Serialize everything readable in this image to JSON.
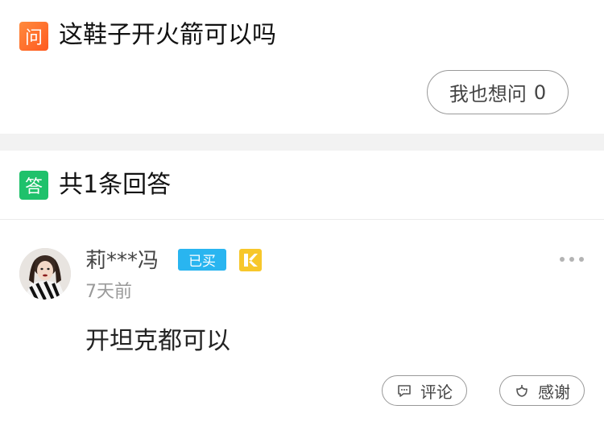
{
  "question": {
    "badge": "问",
    "title": "这鞋子开火箭可以吗",
    "ask_button_label": "我也想问",
    "ask_count": "0"
  },
  "answers_header": {
    "badge": "答",
    "count_label": "共1条回答"
  },
  "answer": {
    "user_name": "莉***冯",
    "bought_tag": "已买",
    "vip_icon": "vip-badge-icon",
    "time": "7天前",
    "text": "开坦克都可以",
    "comment_label": "评论",
    "thanks_label": "感谢"
  },
  "colors": {
    "question_badge": "#ff6a2a",
    "answer_badge": "#1fc16b",
    "bought_tag": "#29b5f0",
    "vip_badge": "#f7c72b"
  }
}
